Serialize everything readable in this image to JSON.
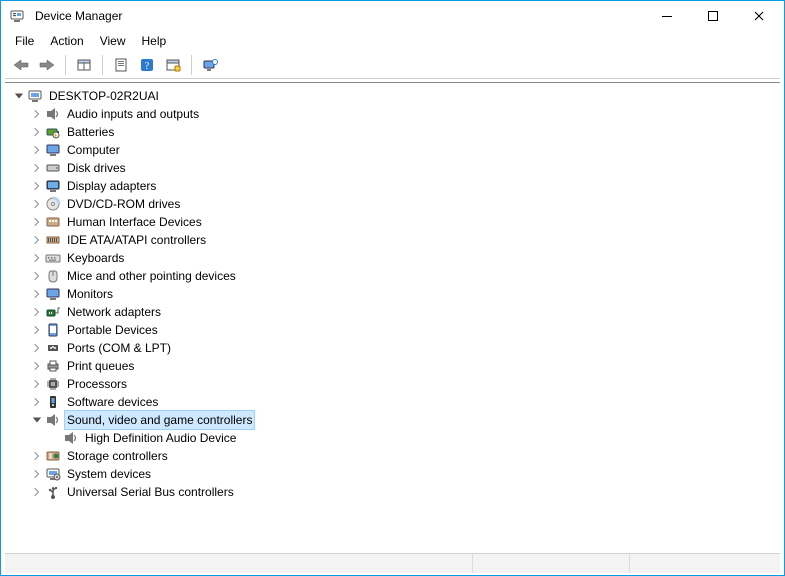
{
  "window": {
    "title": "Device Manager"
  },
  "menu": {
    "items": [
      "File",
      "Action",
      "View",
      "Help"
    ]
  },
  "toolbar": {
    "back": "Back",
    "forward": "Forward",
    "properties": "Properties",
    "help": "Help"
  },
  "tree": {
    "root": {
      "label": "DESKTOP-02R2UAI",
      "expanded": true,
      "children": [
        {
          "label": "Audio inputs and outputs",
          "icon": "sound",
          "expanded": false
        },
        {
          "label": "Batteries",
          "icon": "battery",
          "expanded": false
        },
        {
          "label": "Computer",
          "icon": "monitor",
          "expanded": false
        },
        {
          "label": "Disk drives",
          "icon": "drive",
          "expanded": false
        },
        {
          "label": "Display adapters",
          "icon": "monitor2",
          "expanded": false
        },
        {
          "label": "DVD/CD-ROM drives",
          "icon": "disc",
          "expanded": false
        },
        {
          "label": "Human Interface Devices",
          "icon": "hid",
          "expanded": false
        },
        {
          "label": "IDE ATA/ATAPI controllers",
          "icon": "ide",
          "expanded": false
        },
        {
          "label": "Keyboards",
          "icon": "keyboard",
          "expanded": false
        },
        {
          "label": "Mice and other pointing devices",
          "icon": "mouse",
          "expanded": false
        },
        {
          "label": "Monitors",
          "icon": "monitor",
          "expanded": false
        },
        {
          "label": "Network adapters",
          "icon": "net",
          "expanded": false
        },
        {
          "label": "Portable Devices",
          "icon": "portable",
          "expanded": false
        },
        {
          "label": "Ports (COM & LPT)",
          "icon": "port",
          "expanded": false
        },
        {
          "label": "Print queues",
          "icon": "print",
          "expanded": false
        },
        {
          "label": "Processors",
          "icon": "cpu",
          "expanded": false
        },
        {
          "label": "Software devices",
          "icon": "sw",
          "expanded": false
        },
        {
          "label": "Sound, video and game controllers",
          "icon": "sound",
          "expanded": true,
          "selected": true,
          "children": [
            {
              "label": "High Definition Audio Device",
              "icon": "sound"
            }
          ]
        },
        {
          "label": "Storage controllers",
          "icon": "storage",
          "expanded": false
        },
        {
          "label": "System devices",
          "icon": "system",
          "expanded": false
        },
        {
          "label": "Universal Serial Bus controllers",
          "icon": "usb",
          "expanded": false
        }
      ]
    }
  }
}
